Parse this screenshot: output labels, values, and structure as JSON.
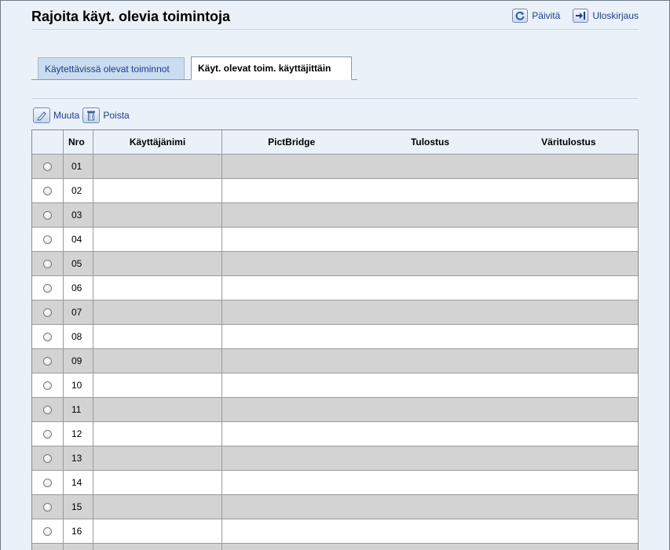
{
  "page": {
    "title": "Rajoita käyt. olevia toimintoja"
  },
  "top_links": {
    "refresh": "Päivitä",
    "logout": "Uloskirjaus"
  },
  "tabs": [
    {
      "label": "Käytettävissä olevat toiminnot",
      "active": false
    },
    {
      "label": "Käyt. olevat toim. käyttäjittäin",
      "active": true
    }
  ],
  "toolbar": {
    "edit": "Muuta",
    "delete": "Poista"
  },
  "table": {
    "columns": {
      "nro": "Nro",
      "username": "Käyttäjänimi",
      "pictbridge": "PictBridge",
      "print": "Tulostus",
      "color_print": "Väritulostus"
    },
    "rows": [
      "01",
      "02",
      "03",
      "04",
      "05",
      "06",
      "07",
      "08",
      "09",
      "10",
      "11",
      "12",
      "13",
      "14",
      "15",
      "16"
    ]
  },
  "colors": {
    "background": "#ebf1f8",
    "link": "#1d3d8c",
    "row_shaded": "#d3d3d3",
    "tab_inactive": "#c9dcf0"
  }
}
